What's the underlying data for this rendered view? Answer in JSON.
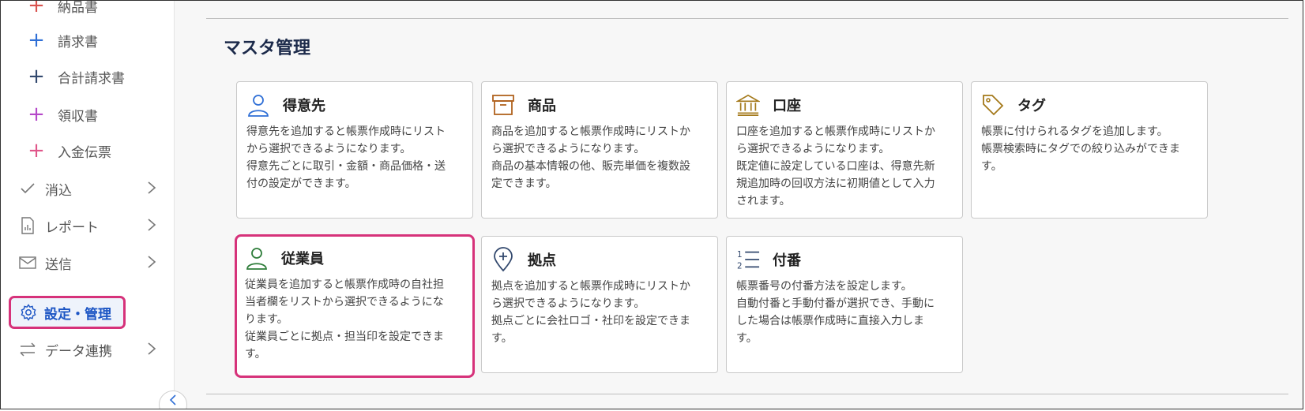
{
  "sidebar": {
    "items": [
      {
        "label": "納品書",
        "icon": "plus-icon",
        "color": "#d9534f"
      },
      {
        "label": "請求書",
        "icon": "plus-icon",
        "color": "#2f6fd6"
      },
      {
        "label": "合計請求書",
        "icon": "plus-icon",
        "color": "#33496e"
      },
      {
        "label": "領収書",
        "icon": "plus-icon",
        "color": "#b548c9"
      },
      {
        "label": "入金伝票",
        "icon": "plus-icon",
        "color": "#e0568a"
      }
    ],
    "groups": [
      {
        "label": "消込",
        "icon": "check-icon"
      },
      {
        "label": "レポート",
        "icon": "report-icon"
      },
      {
        "label": "送信",
        "icon": "mail-icon"
      },
      {
        "label": "設定・管理",
        "icon": "gear-icon",
        "active": true
      },
      {
        "label": "データ連携",
        "icon": "sync-arrows-icon"
      }
    ],
    "collapse_icon": "chevron-left-icon"
  },
  "main": {
    "section_title": "マスタ管理",
    "cards": [
      {
        "title": "得意先",
        "icon": "person-icon",
        "icon_color": "#2f6fd6",
        "description": "得意先を追加すると帳票作成時にリスト\nから選択できるようになります。\n得意先ごとに取引・金額・商品価格・送\n付の設定ができます。"
      },
      {
        "title": "商品",
        "icon": "box-icon",
        "icon_color": "#b0621e",
        "description": "商品を追加すると帳票作成時にリストか\nら選択できるようになります。\n商品の基本情報の他、販売単価を複数設\n定できます。"
      },
      {
        "title": "口座",
        "icon": "bank-icon",
        "icon_color": "#a4791a",
        "description": "口座を追加すると帳票作成時にリストか\nら選択できるようになります。\n既定値に設定している口座は、得意先新\n規追加時の回収方法に初期値として入力\nされます。"
      },
      {
        "title": "タグ",
        "icon": "tag-icon",
        "icon_color": "#a4791a",
        "description": "帳票に付けられるタグを追加します。\n帳票検索時にタグでの絞り込みができま\nす。"
      },
      {
        "title": "従業員",
        "icon": "person-icon",
        "icon_color": "#2e7d3a",
        "highlighted": true,
        "description": "従業員を追加すると帳票作成時の自社担\n当者欄をリストから選択できるようにな\nります。\n従業員ごとに拠点・担当印を設定できま\nす。"
      },
      {
        "title": "拠点",
        "icon": "location-pin-icon",
        "icon_color": "#33496e",
        "description": "拠点を追加すると帳票作成時にリストか\nら選択できるようになります。\n拠点ごとに会社ロゴ・社印を設定できま\nす。"
      },
      {
        "title": "付番",
        "icon": "numbered-list-icon",
        "icon_color": "#33496e",
        "description": "帳票番号の付番方法を設定します。\n自動付番と手動付番が選択でき、手動に\nした場合は帳票作成時に直接入力しま\nす。"
      }
    ]
  }
}
